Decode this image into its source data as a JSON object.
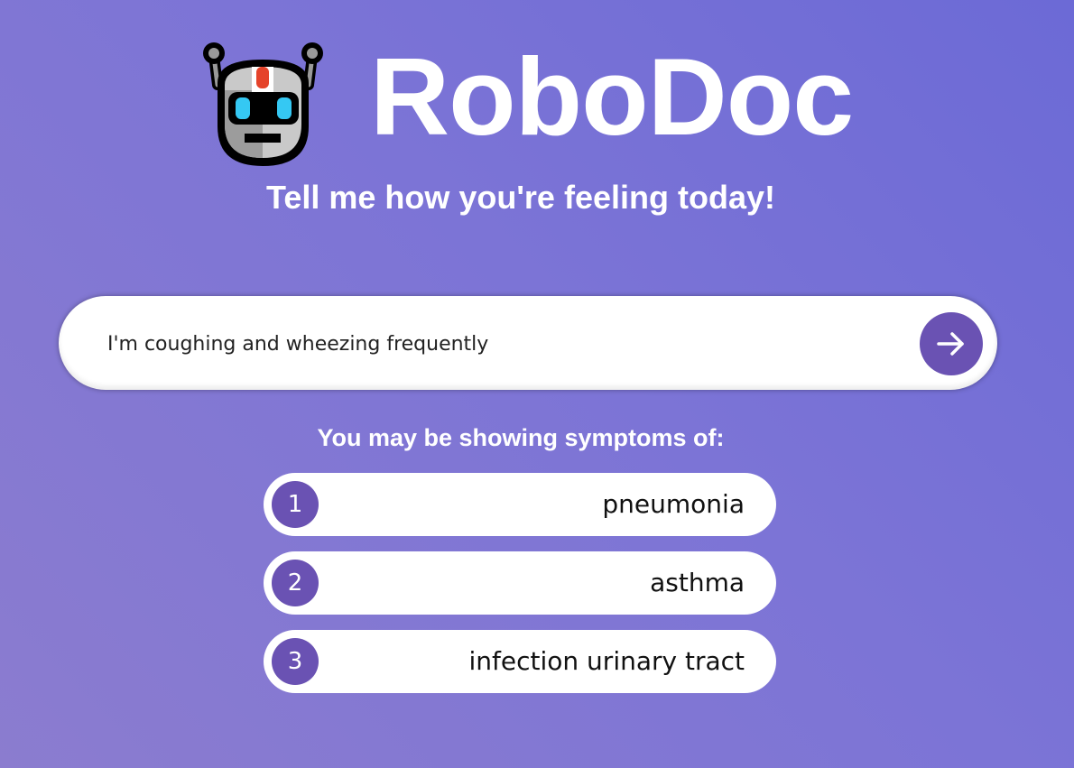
{
  "app": {
    "title": "RoboDoc",
    "tagline": "Tell me how you're feeling today!",
    "logo_icon": "robot-face-icon"
  },
  "search": {
    "value": "I'm coughing and wheezing frequently",
    "placeholder": "",
    "submit_icon": "arrow-right-icon"
  },
  "results": {
    "heading": "You may be showing symptoms of:",
    "items": [
      {
        "rank": "1",
        "condition": "pneumonia"
      },
      {
        "rank": "2",
        "condition": "asthma"
      },
      {
        "rank": "3",
        "condition": "infection urinary tract"
      }
    ]
  },
  "colors": {
    "background": "#7a72d6",
    "accent": "#6a52b3",
    "card": "#ffffff"
  }
}
